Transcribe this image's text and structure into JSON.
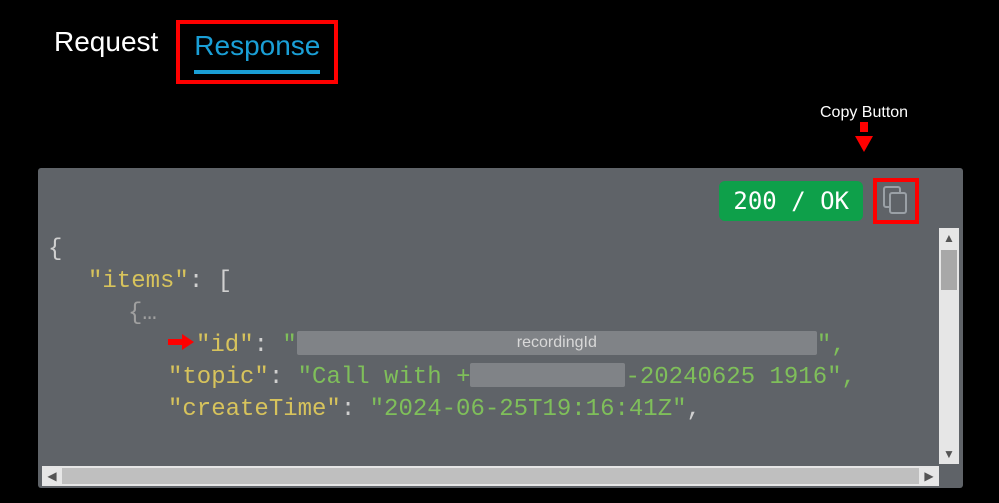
{
  "tabs": {
    "request": "Request",
    "response": "Response"
  },
  "annotations": {
    "copy_button_label": "Copy Button",
    "recording_id_placeholder": "recordingId"
  },
  "status": {
    "text": "200 / OK"
  },
  "response_body": {
    "open_brace": "{",
    "items_key": "\"items\"",
    "colon_bracket": ": [",
    "inner_open": "{…",
    "id_key": "\"id\"",
    "id_colon_q": ": \"",
    "id_tail": "\",",
    "topic_key": "\"topic\"",
    "topic_colon_q": ": \"Call with +",
    "topic_tail": "-20240625 1916\",",
    "create_key": "\"createTime\"",
    "create_val": ": \"2024-06-25T19:16:41Z\","
  },
  "create_val_str": "\"2024-06-25T19:16:41Z\""
}
